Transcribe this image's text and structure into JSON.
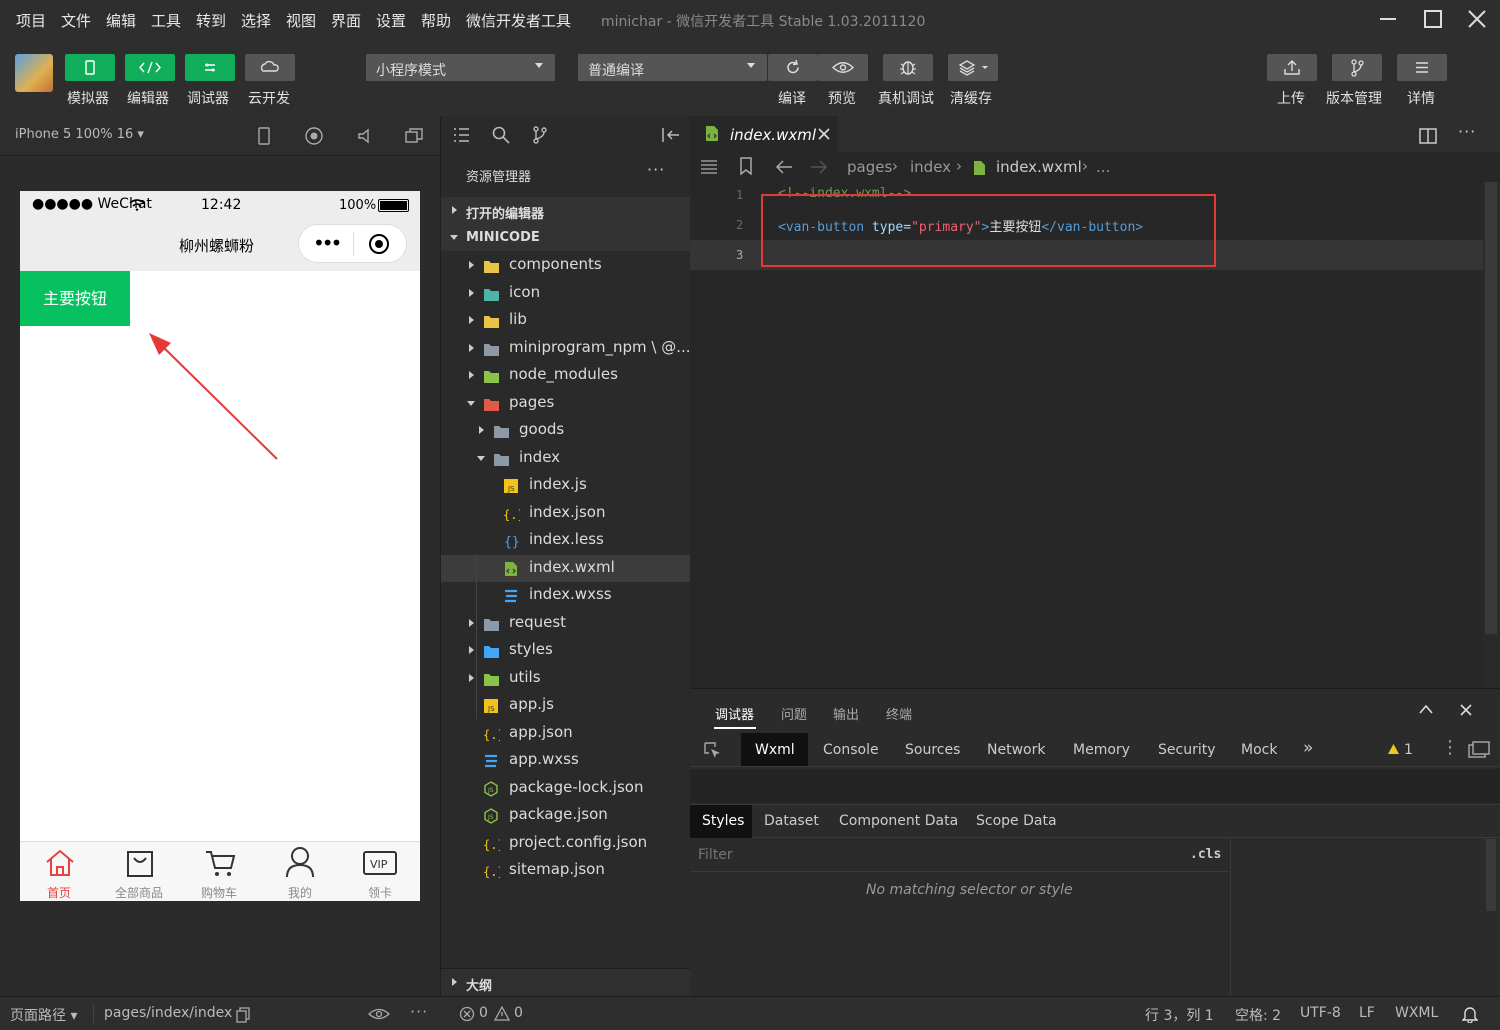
{
  "menu": [
    "项目",
    "文件",
    "编辑",
    "工具",
    "转到",
    "选择",
    "视图",
    "界面",
    "设置",
    "帮助",
    "微信开发者工具"
  ],
  "window_title": "minichar - 微信开发者工具 Stable 1.03.2011120",
  "toolbar": {
    "simulator": "模拟器",
    "editor": "编辑器",
    "debugger": "调试器",
    "cloud": "云开发",
    "mode_select": "小程序模式",
    "compile_select": "普通编译",
    "compile": "编译",
    "preview": "预览",
    "device_debug": "真机调试",
    "clear_cache": "清缓存",
    "upload": "上传",
    "version": "版本管理",
    "details": "详情"
  },
  "simulator": {
    "device": "iPhone 5 100% 16 ▾",
    "carrier": "●●●●● WeChat",
    "time": "12:42",
    "battery": "100%",
    "nav_title": "柳州螺蛳粉",
    "button_text": "主要按钮",
    "tabs": [
      "首页",
      "全部商品",
      "购物车",
      "我的",
      "领卡"
    ],
    "active_color": "#e64340",
    "button_color": "#07c160"
  },
  "explorer": {
    "title": "资源管理器",
    "open_editors": "打开的编辑器",
    "project": "MINICODE",
    "outline": "大纲",
    "tree": [
      {
        "name": "components",
        "type": "folder",
        "depth": 0,
        "open": false,
        "icon": "folder-yellow"
      },
      {
        "name": "icon",
        "type": "folder",
        "depth": 0,
        "open": false,
        "icon": "folder-teal"
      },
      {
        "name": "lib",
        "type": "folder",
        "depth": 0,
        "open": false,
        "icon": "folder-yellow"
      },
      {
        "name": "miniprogram_npm \\ @...",
        "type": "folder",
        "depth": 0,
        "open": false,
        "icon": "folder-gray"
      },
      {
        "name": "node_modules",
        "type": "folder",
        "depth": 0,
        "open": false,
        "icon": "folder-green"
      },
      {
        "name": "pages",
        "type": "folder",
        "depth": 0,
        "open": true,
        "icon": "folder-red"
      },
      {
        "name": "goods",
        "type": "folder",
        "depth": 1,
        "open": false,
        "icon": "folder-gray"
      },
      {
        "name": "index",
        "type": "folder",
        "depth": 1,
        "open": true,
        "icon": "folder-gray-open"
      },
      {
        "name": "index.js",
        "type": "file",
        "depth": 2,
        "icon": "js"
      },
      {
        "name": "index.json",
        "type": "file",
        "depth": 2,
        "icon": "json"
      },
      {
        "name": "index.less",
        "type": "file",
        "depth": 2,
        "icon": "less"
      },
      {
        "name": "index.wxml",
        "type": "file",
        "depth": 2,
        "icon": "wxml",
        "selected": true
      },
      {
        "name": "index.wxss",
        "type": "file",
        "depth": 2,
        "icon": "wxss"
      },
      {
        "name": "request",
        "type": "folder",
        "depth": 0,
        "open": false,
        "icon": "folder-gray"
      },
      {
        "name": "styles",
        "type": "folder",
        "depth": 0,
        "open": false,
        "icon": "folder-blue"
      },
      {
        "name": "utils",
        "type": "folder",
        "depth": 0,
        "open": false,
        "icon": "folder-green"
      },
      {
        "name": "app.js",
        "type": "file",
        "depth": 0,
        "icon": "js"
      },
      {
        "name": "app.json",
        "type": "file",
        "depth": 0,
        "icon": "json"
      },
      {
        "name": "app.wxss",
        "type": "file",
        "depth": 0,
        "icon": "wxss"
      },
      {
        "name": "package-lock.json",
        "type": "file",
        "depth": 0,
        "icon": "node"
      },
      {
        "name": "package.json",
        "type": "file",
        "depth": 0,
        "icon": "node"
      },
      {
        "name": "project.config.json",
        "type": "file",
        "depth": 0,
        "icon": "json"
      },
      {
        "name": "sitemap.json",
        "type": "file",
        "depth": 0,
        "icon": "json"
      }
    ]
  },
  "editor": {
    "tab": "index.wxml",
    "breadcrumb": [
      "pages",
      "index",
      "index.wxml",
      "..."
    ],
    "line_numbers": [
      "1",
      "2",
      "3"
    ],
    "line1": "<!--index.wxml-->",
    "line2": {
      "open_tag": "<van-button",
      "attr": " type=",
      "value": "\"primary\"",
      "close": ">",
      "text": "主要按钮",
      "end_tag": "</van-button>"
    }
  },
  "devtools": {
    "top_tabs": [
      "调试器",
      "问题",
      "输出",
      "终端"
    ],
    "panels": [
      "Wxml",
      "Console",
      "Sources",
      "Network",
      "Memory",
      "Security",
      "Mock"
    ],
    "warning_count": "1",
    "style_tabs": [
      "Styles",
      "Dataset",
      "Component Data",
      "Scope Data"
    ],
    "filter_placeholder": "Filter",
    "cls": ".cls",
    "empty_message": "No matching selector or style"
  },
  "status": {
    "page_path_label": "页面路径 ▾",
    "page_path": "pages/index/index",
    "errors": "0",
    "warnings": "0",
    "position": "行 3，列 1",
    "spaces": "空格: 2",
    "encoding": "UTF-8",
    "eol": "LF",
    "language": "WXML"
  }
}
